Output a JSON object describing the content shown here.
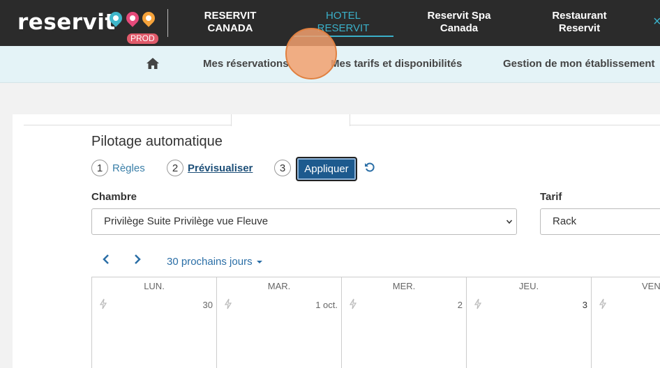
{
  "header": {
    "logo": "reservit",
    "badge": "PROD",
    "links": [
      {
        "label": "RESERVIT\nCANADA",
        "l1": "RESERVIT",
        "l2": "CANADA"
      },
      {
        "label": "HOTEL\nRESERVIT",
        "l1": "HOTEL",
        "l2": "RESERVIT",
        "active": true
      },
      {
        "label": "Reservit Spa\nCanada",
        "l1": "Reservit Spa",
        "l2": "Canada"
      },
      {
        "label": "Restaurant\nReservit",
        "l1": "Restaurant",
        "l2": "Reservit"
      }
    ],
    "close_glyph": "×",
    "colors": {
      "bar": "#2b2b2b",
      "accent": "#3ab0c9",
      "badge": "#e05a6a"
    }
  },
  "subnav": {
    "home_icon": "home-icon",
    "items": [
      "Mes réservations",
      "Mes tarifs et disponibilités",
      "Gestion de mon établissement"
    ]
  },
  "main": {
    "section_title": "Pilotage automatique",
    "steps": [
      {
        "num": "1",
        "label": "Règles"
      },
      {
        "num": "2",
        "label": "Prévisualiser"
      },
      {
        "num": "3",
        "label": "Appliquer"
      }
    ],
    "reset_icon": "undo-icon",
    "room_label": "Chambre",
    "room_value": "Privilège Suite Privilège vue Fleuve",
    "rate_label": "Tarif",
    "rate_value": "Rack",
    "prev_glyph": "‹",
    "next_glyph": "›",
    "range_label": "30 prochains jours",
    "days": [
      {
        "name": "LUN.",
        "date": "30"
      },
      {
        "name": "MAR.",
        "date": "1 oct."
      },
      {
        "name": "MER.",
        "date": "2"
      },
      {
        "name": "JEU.",
        "date": "3"
      },
      {
        "name": "VEN",
        "date": ""
      }
    ]
  }
}
